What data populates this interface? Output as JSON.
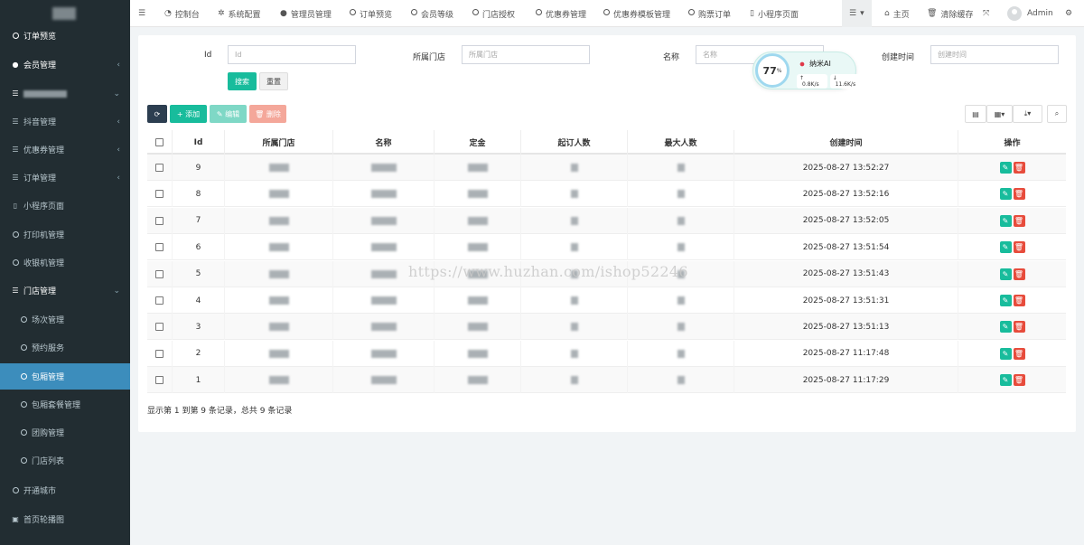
{
  "sidebar": {
    "items": [
      {
        "label": "订单预览",
        "icon": "circle-icon",
        "active": false
      },
      {
        "label": "会员管理",
        "icon": "user-icon",
        "active": false
      },
      {
        "label": "",
        "icon": "list-icon",
        "active": false
      },
      {
        "label": "抖音管理",
        "icon": "list-icon",
        "active": false
      },
      {
        "label": "优惠券管理",
        "icon": "list-icon",
        "active": false
      },
      {
        "label": "订单管理",
        "icon": "list-icon",
        "active": false
      },
      {
        "label": "小程序页面",
        "icon": "bookmark-icon",
        "active": false
      },
      {
        "label": "打印机管理",
        "icon": "circle-icon",
        "active": false
      },
      {
        "label": "收银机管理",
        "icon": "circle-icon",
        "active": false
      },
      {
        "label": "门店管理",
        "icon": "list-icon",
        "active": false
      },
      {
        "label": "场次管理",
        "icon": "circle-icon",
        "active": false
      },
      {
        "label": "预约服务",
        "icon": "circle-icon",
        "active": false
      },
      {
        "label": "包厢管理",
        "icon": "circle-icon",
        "active": true
      },
      {
        "label": "包厢套餐管理",
        "icon": "circle-icon",
        "active": false
      },
      {
        "label": "团购管理",
        "icon": "circle-icon",
        "active": false
      },
      {
        "label": "门店列表",
        "icon": "circle-icon",
        "active": false
      },
      {
        "label": "开通城市",
        "icon": "circle-icon",
        "active": false
      },
      {
        "label": "首页轮播图",
        "icon": "image-icon",
        "active": false
      }
    ]
  },
  "topbar": {
    "nav": [
      "控制台",
      "系统配置",
      "管理员管理",
      "订单预览",
      "会员等级",
      "门店授权",
      "优惠券管理",
      "优惠券模板管理",
      "购票订单",
      "小程序页面"
    ],
    "home": "主页",
    "clear_cache": "清除缓存",
    "user": "Admin"
  },
  "filters": {
    "id_label": "Id",
    "id_placeholder": "Id",
    "store_label": "所属门店",
    "store_placeholder": "所属门店",
    "name_label": "名称",
    "name_placeholder": "名称",
    "created_label": "创建时间",
    "created_placeholder": "创建时间",
    "search": "搜索",
    "reset": "重置"
  },
  "toolbar": {
    "add": "添加",
    "edit": "编辑",
    "delete": "删除"
  },
  "widget": {
    "percent": "77",
    "percent_unit": "%",
    "brand": "纳米AI",
    "up": "0.8K/s",
    "down": "11.6K/s"
  },
  "table": {
    "headers": [
      "Id",
      "所属门店",
      "名称",
      "定金",
      "起订人数",
      "最大人数",
      "创建时间",
      "操作"
    ],
    "rows": [
      {
        "id": "9",
        "created": "2025-08-27 13:52:27"
      },
      {
        "id": "8",
        "created": "2025-08-27 13:52:16"
      },
      {
        "id": "7",
        "created": "2025-08-27 13:52:05"
      },
      {
        "id": "6",
        "created": "2025-08-27 13:51:54"
      },
      {
        "id": "5",
        "created": "2025-08-27 13:51:43"
      },
      {
        "id": "4",
        "created": "2025-08-27 13:51:31"
      },
      {
        "id": "3",
        "created": "2025-08-27 13:51:13"
      },
      {
        "id": "2",
        "created": "2025-08-27 11:17:48"
      },
      {
        "id": "1",
        "created": "2025-08-27 11:17:29"
      }
    ]
  },
  "summary": "显示第 1 到第 9 条记录，总共 9 条记录",
  "watermark": "https://www.huzhan.com/ishop52246",
  "colors": {
    "sidebar": "#222d32",
    "active": "#3c8dbc",
    "green": "#18bc9c",
    "red": "#e74c3c",
    "dark": "#2c3e50"
  }
}
